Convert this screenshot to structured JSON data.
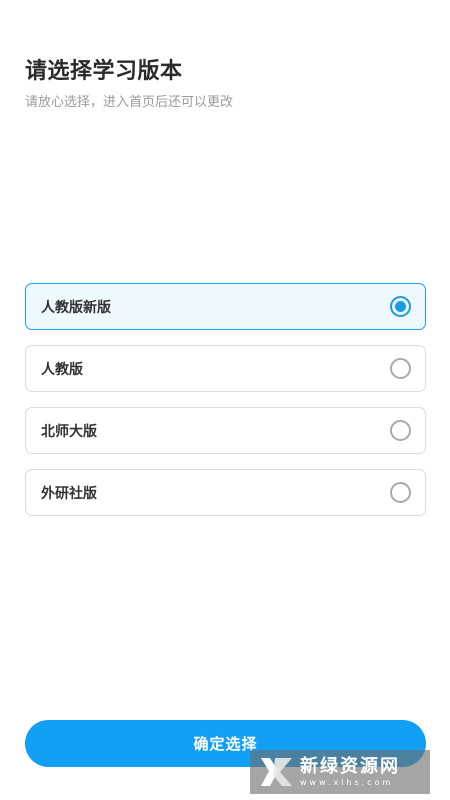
{
  "header": {
    "title": "请选择学习版本",
    "subtitle": "请放心选择，进入首页后还可以更改"
  },
  "options": [
    {
      "label": "人教版新版",
      "selected": true
    },
    {
      "label": "人教版",
      "selected": false
    },
    {
      "label": "北师大版",
      "selected": false
    },
    {
      "label": "外研社版",
      "selected": false
    }
  ],
  "confirm_label": "确定选择",
  "watermark": {
    "name": "新绿资源网",
    "url": "www.xlhs.com"
  },
  "colors": {
    "accent": "#11a0f5",
    "selected_border": "#1aa3e8",
    "selected_bg": "#eef8fd",
    "radio_unselected": "#a9a9a9"
  }
}
